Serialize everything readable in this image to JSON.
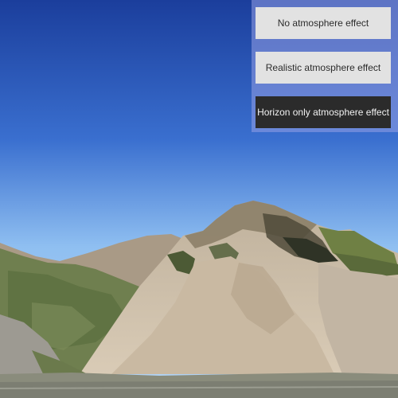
{
  "scene": {
    "view": "3d-terrain-mountain",
    "sky_top_color": "#1b3e9c",
    "sky_horizon_color": "#8fbff1"
  },
  "atmosphere_panel": {
    "buttons": [
      {
        "id": "none",
        "label": "No atmosphere effect",
        "selected": false
      },
      {
        "id": "realistic",
        "label": "Realistic atmosphere effect",
        "selected": false
      },
      {
        "id": "horizon",
        "label": "Horizon only atmosphere effect",
        "selected": true
      }
    ]
  }
}
